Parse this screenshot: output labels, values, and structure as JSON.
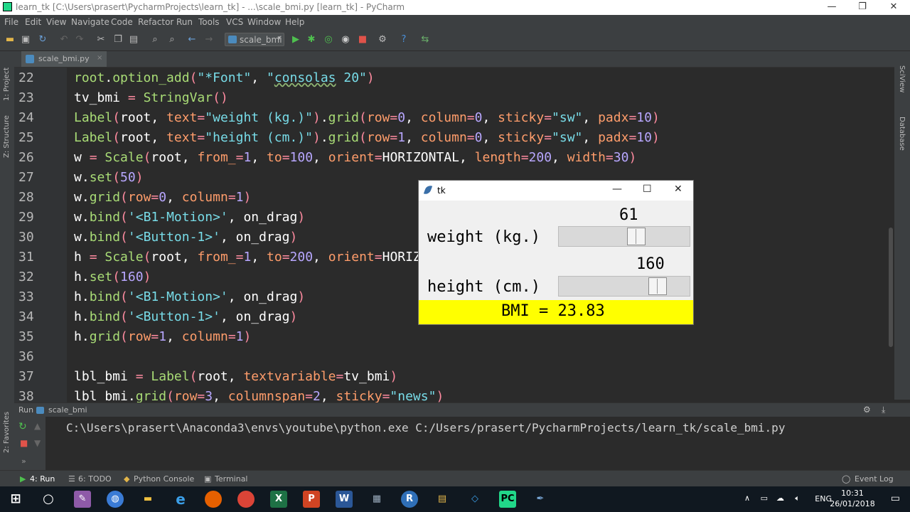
{
  "window": {
    "title": "learn_tk [C:\\Users\\prasert\\PycharmProjects\\learn_tk] - ...\\scale_bmi.py [learn_tk] - PyCharm",
    "minimize": "—",
    "restore": "❐",
    "close": "✕"
  },
  "menu": {
    "items": [
      "File",
      "Edit",
      "View",
      "Navigate",
      "Code",
      "Refactor",
      "Run",
      "Tools",
      "VCS",
      "Window",
      "Help"
    ]
  },
  "toolbar": {
    "run_config": "scale_bmi",
    "dropdown": "▾"
  },
  "side": {
    "project": "1: Project",
    "structure": "Z: Structure",
    "favorites": "2: Favorites",
    "sciview": "SciView",
    "database": "Database"
  },
  "tab": {
    "label": "scale_bmi.py",
    "close": "×"
  },
  "editor": {
    "line_numbers": [
      "22",
      "23",
      "24",
      "25",
      "26",
      "27",
      "28",
      "29",
      "30",
      "31",
      "32",
      "33",
      "34",
      "35",
      "36",
      "37",
      "38"
    ]
  },
  "run_panel": {
    "label": "Run",
    "config": "scale_bmi",
    "command": "C:\\Users\\prasert\\Anaconda3\\envs\\youtube\\python.exe C:/Users/prasert/PycharmProjects/learn_tk/scale_bmi.py"
  },
  "bottom_tabs": {
    "run": "4: Run",
    "todo": "6: TODO",
    "python_console": "Python Console",
    "terminal": "Terminal",
    "event_log": "Event Log"
  },
  "tk_window": {
    "title": "tk",
    "weight_label": "weight (kg.)",
    "weight_value": "61",
    "weight_range": [
      1,
      100
    ],
    "height_label": "height (cm.)",
    "height_value": "160",
    "height_range": [
      1,
      200
    ],
    "bmi_text": "BMI = 23.83",
    "bmi_bg": "#ffff00"
  },
  "taskbar": {
    "lang": "ENG",
    "time": "10:31",
    "date": "26/01/2018"
  }
}
